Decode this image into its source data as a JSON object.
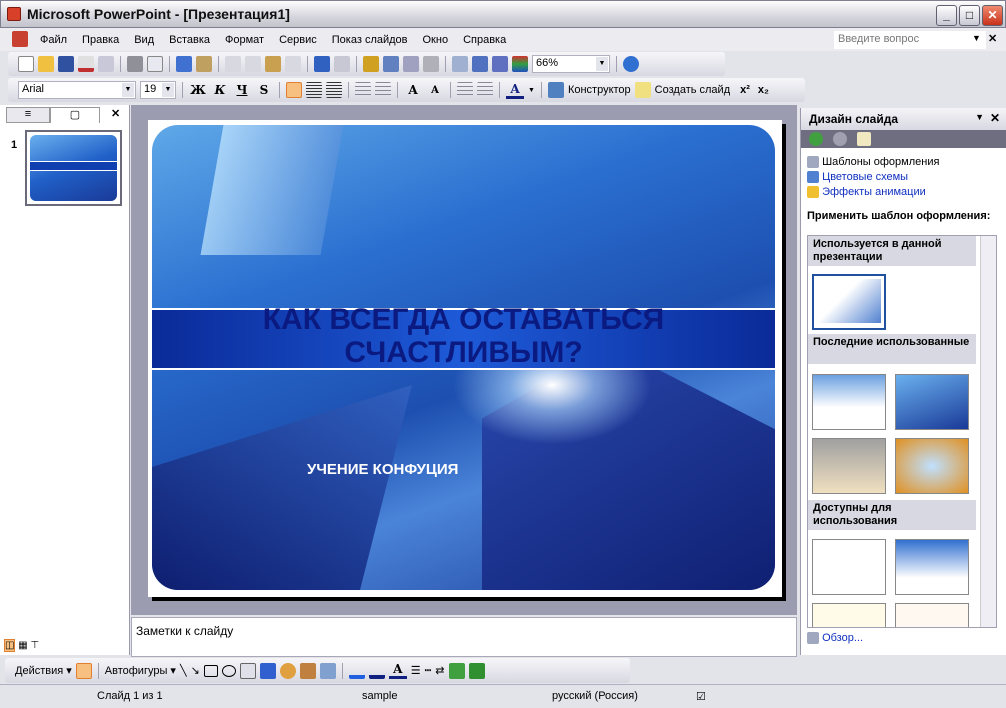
{
  "window": {
    "title": "Microsoft PowerPoint - [Презентация1]"
  },
  "menu": {
    "items": [
      "Файл",
      "Правка",
      "Вид",
      "Вставка",
      "Формат",
      "Сервис",
      "Показ слайдов",
      "Окно",
      "Справка"
    ],
    "ask_placeholder": "Введите вопрос"
  },
  "standard_toolbar": {
    "zoom": "66%"
  },
  "formatting_toolbar": {
    "font": "Arial",
    "size": "19",
    "bold": "Ж",
    "italic": "К",
    "underline": "Ч",
    "shadow": "S",
    "designer": "Конструктор",
    "new_slide": "Создать слайд",
    "superscript": "x²",
    "subscript": "x₂"
  },
  "slides_pane": {
    "slide_number": "1"
  },
  "slide": {
    "title": "КАК ВСЕГДА ОСТАВАТЬСЯ СЧАСТЛИВЫМ?",
    "subtitle": "УЧЕНИЕ КОНФУЦИЯ"
  },
  "notes": {
    "placeholder": "Заметки к слайду"
  },
  "task_pane": {
    "title": "Дизайн слайда",
    "links": [
      "Шаблоны оформления",
      "Цветовые схемы",
      "Эффекты анимации"
    ],
    "apply_label": "Применить шаблон оформления:",
    "sections": [
      "Используется в данной презентации",
      "Последние использованные",
      "Доступны для использования"
    ],
    "browse": "Обзор..."
  },
  "drawing_toolbar": {
    "actions": "Действия",
    "autoshapes": "Автофигуры"
  },
  "status": {
    "slide": "Слайд 1 из 1",
    "design": "sample",
    "language": "русский (Россия)"
  },
  "colors": {
    "accent": "#1030c0",
    "slide_title": "#0a1a80"
  }
}
